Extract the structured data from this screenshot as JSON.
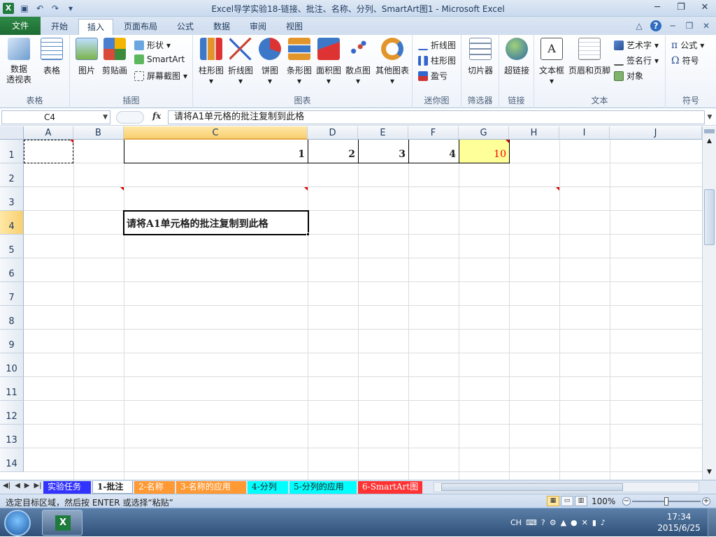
{
  "window": {
    "title": "Excel导学实验18-链接、批注、名称、分列、SmartArt图1 - Microsoft Excel"
  },
  "tabs": [
    "文件",
    "开始",
    "插入",
    "页面布局",
    "公式",
    "数据",
    "审阅",
    "视图"
  ],
  "ribbon": {
    "groups": {
      "table": {
        "label": "表格",
        "items": [
          "数据\n透视表",
          "表格"
        ]
      },
      "illustrations": {
        "label": "插图",
        "items": [
          "图片",
          "剪贴画"
        ],
        "small": [
          "形状",
          "SmartArt",
          "屏幕截图"
        ]
      },
      "charts": {
        "label": "图表",
        "items": [
          "柱形图",
          "折线图",
          "饼图",
          "条形图",
          "面积图",
          "散点图",
          "其他图表"
        ]
      },
      "sparklines": {
        "label": "迷你图",
        "items": [
          "折线图",
          "柱形图",
          "盈亏"
        ]
      },
      "filter": {
        "label": "筛选器",
        "items": [
          "切片器"
        ]
      },
      "links": {
        "label": "链接",
        "items": [
          "超链接"
        ]
      },
      "text": {
        "label": "文本",
        "items": [
          "文本框",
          "页眉和页脚"
        ],
        "small": [
          "艺术字",
          "签名行",
          "对象"
        ]
      },
      "symbols": {
        "label": "符号",
        "small": [
          "公式",
          "符号"
        ]
      }
    }
  },
  "formula_bar": {
    "name_box": "C4",
    "fx": "fx",
    "content": "请将A1单元格的批注复制到此格"
  },
  "columns": [
    "A",
    "B",
    "C",
    "D",
    "E",
    "F",
    "G",
    "H",
    "I",
    "J"
  ],
  "rows": [
    "1",
    "2",
    "3",
    "4",
    "5",
    "6",
    "7",
    "8",
    "9",
    "10",
    "11",
    "12",
    "13",
    "14"
  ],
  "cells": {
    "C1": "1",
    "D1": "2",
    "E1": "3",
    "F1": "4",
    "G1": "10",
    "C4": "请将A1单元格的批注复制到此格"
  },
  "colors": {
    "g1_fill": "#ffff99",
    "g1_text": "#ff0000",
    "file_tab": "#217346"
  },
  "sheet_tabs": [
    {
      "label": "实验任务",
      "color": "#3333ff"
    },
    {
      "label": "1-批注",
      "color": "#ffffff"
    },
    {
      "label": "2-名称",
      "color": "#ff9933"
    },
    {
      "label": "3-名称的应用",
      "color": "#ff9933"
    },
    {
      "label": "4-分列",
      "color": "#00ffff"
    },
    {
      "label": "5-分列的应用",
      "color": "#00ffff"
    },
    {
      "label": "6-SmartArt图",
      "color": "#ff3333"
    }
  ],
  "status": {
    "message": "选定目标区域，然后按 ENTER 或选择“粘贴”",
    "zoom": "100%"
  },
  "taskbar": {
    "lang": "CH",
    "time": "17:34",
    "date": "2015/6/25"
  }
}
